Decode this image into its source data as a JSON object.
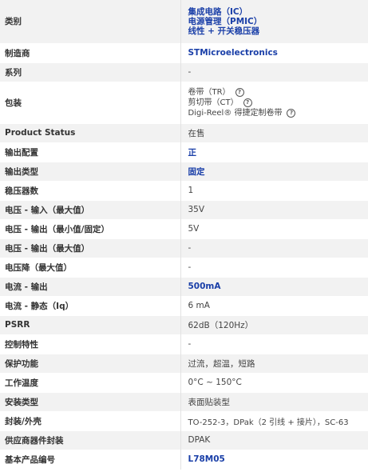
{
  "rows": {
    "category": {
      "label": "类别",
      "links": [
        "集成电路（IC）",
        "电源管理（PMIC）",
        "线性 + 开关稳压器"
      ]
    },
    "manufacturer": {
      "label": "制造商",
      "value": "STMicroelectronics"
    },
    "series": {
      "label": "系列",
      "value": "-"
    },
    "packaging": {
      "label": "包装",
      "options": [
        "卷带（TR）",
        "剪切带（CT）",
        "Digi-Reel® 得捷定制卷带"
      ]
    },
    "product_status": {
      "label": "Product Status",
      "value": "在售"
    },
    "output_config": {
      "label": "输出配置",
      "value": "正"
    },
    "output_type": {
      "label": "输出类型",
      "value": "固定"
    },
    "regulator_count": {
      "label": "稳压器数",
      "value": "1"
    },
    "voltage_input_max": {
      "label": "电压 - 输入（最大值）",
      "value": "35V"
    },
    "voltage_output_minfixed": {
      "label": "电压 - 输出（最小值/固定）",
      "value": "5V"
    },
    "voltage_output_max": {
      "label": "电压 - 输出（最大值）",
      "value": "-"
    },
    "dropout_max": {
      "label": "电压降（最大值）",
      "value": "-"
    },
    "current_output": {
      "label": "电流 - 输出",
      "value": "500mA"
    },
    "current_quiescent": {
      "label": "电流 - 静态（Iq）",
      "value": "6 mA"
    },
    "psrr": {
      "label": "PSRR",
      "value": "62dB（120Hz）"
    },
    "control_features": {
      "label": "控制特性",
      "value": "-"
    },
    "protection": {
      "label": "保护功能",
      "value": "过流，超温，短路"
    },
    "operating_temp": {
      "label": "工作温度",
      "value": "0°C ~ 150°C"
    },
    "mounting": {
      "label": "安装类型",
      "value": "表面贴装型"
    },
    "package_case": {
      "label": "封装/外壳",
      "value": "TO-252-3，DPak（2 引线 + 接片），SC-63"
    },
    "supplier_package": {
      "label": "供应商器件封装",
      "value": "DPAK"
    },
    "base_part": {
      "label": "基本产品编号",
      "value": "L78M05"
    }
  }
}
